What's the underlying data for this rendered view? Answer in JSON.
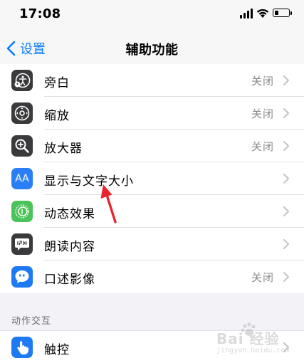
{
  "status_bar": {
    "time": "17:08"
  },
  "nav": {
    "back_label": "设置",
    "title": "辅助功能"
  },
  "rows": [
    {
      "label": "旁白",
      "value": "关闭",
      "icon": "voiceover-icon",
      "icon_color": "#3a3a3c"
    },
    {
      "label": "缩放",
      "value": "关闭",
      "icon": "zoom-icon",
      "icon_color": "#3a3a3c"
    },
    {
      "label": "放大器",
      "value": "关闭",
      "icon": "magnifier-icon",
      "icon_color": "#3a3a3c"
    },
    {
      "label": "显示与文字大小",
      "value": "",
      "icon": "text-size-icon",
      "icon_color": "#2b7ff5"
    },
    {
      "label": "动态效果",
      "value": "",
      "icon": "motion-icon",
      "icon_color": "#4cc35a"
    },
    {
      "label": "朗读内容",
      "value": "",
      "icon": "spoken-content-icon",
      "icon_color": "#3a3a3c"
    },
    {
      "label": "口述影像",
      "value": "关闭",
      "icon": "audio-description-icon",
      "icon_color": "#1e7af0"
    }
  ],
  "section2": {
    "header": "动作交互",
    "rows": [
      {
        "label": "触控",
        "value": "",
        "icon": "touch-icon",
        "icon_color": "#1e7af0"
      }
    ]
  },
  "icons": {
    "row0": "AA",
    "row5": "(((●"
  },
  "watermark": {
    "main": "Bai 经验",
    "sub": "jingyan.baidu.com"
  },
  "annotation_color": "#e8262b"
}
